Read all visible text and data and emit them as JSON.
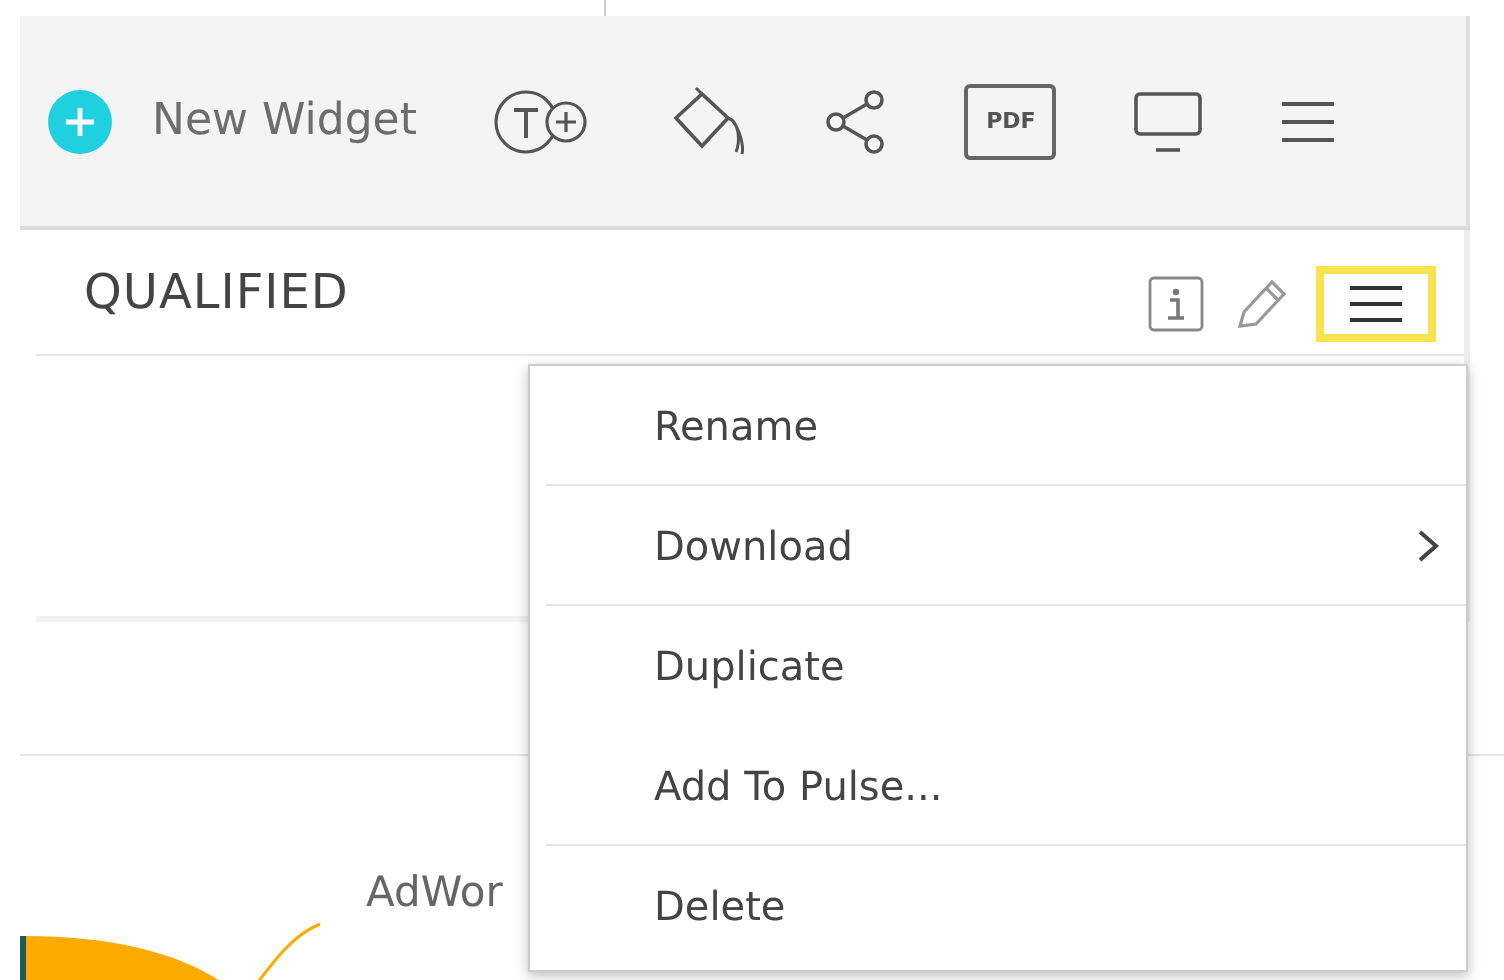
{
  "toolbar": {
    "new_widget": {
      "label": "New Widget"
    },
    "pdf_button": {
      "label": "PDF"
    }
  },
  "widget": {
    "title": "QUALIFIED",
    "menu_button": {
      "selected": true
    }
  },
  "chart_label": "AdWor",
  "context_menu": {
    "items": [
      {
        "label": "Rename",
        "submenu": false,
        "divider_after": true
      },
      {
        "label": "Download",
        "submenu": true,
        "divider_after": true
      },
      {
        "label": "Duplicate",
        "submenu": false,
        "divider_after": false
      },
      {
        "label": "Add To Pulse...",
        "submenu": false,
        "divider_after": true
      },
      {
        "label": "Delete",
        "submenu": false,
        "divider_after": false
      }
    ]
  }
}
